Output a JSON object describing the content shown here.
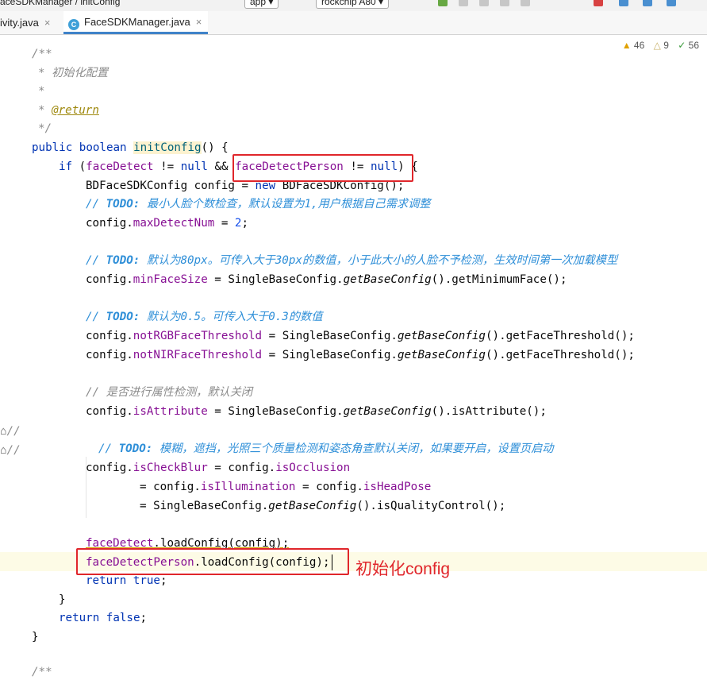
{
  "topbar": {
    "breadcrumb": "aceSDKManager  /  initConfig",
    "run_config": "app ▾",
    "device": "rockchip A80 ▾"
  },
  "tabs": [
    {
      "label": "ivity.java",
      "close": "×"
    },
    {
      "label": "FaceSDKManager.java",
      "close": "×",
      "active": true
    }
  ],
  "inspections": {
    "warnings": "46",
    "weak_warnings": "9",
    "ok": "56"
  },
  "code": {
    "l1": "/**",
    "l2": "* 初始化配置",
    "l3": "*",
    "l4_star": "* ",
    "l4_ann": "@return",
    "l5": "*/",
    "l6_kw": "public boolean ",
    "l6_m": "initConfig",
    "l6_rest": "() {",
    "l7_kw": "if ",
    "l7_a": "(",
    "l7_f1": "faceDetect",
    "l7_b": " != ",
    "l7_null1": "null",
    "l7_c": " && ",
    "l7_f2": "faceDetectPerson",
    "l7_d": " != ",
    "l7_null2": "null",
    "l7_e": ") {",
    "l8_a": "BDFaceSDKConfig config = ",
    "l8_kw": "new",
    "l8_b": " BDFaceSDKConfig();",
    "l9_slash": "// ",
    "l9_todo": "TODO:",
    "l9_text": " 最小人脸个数检查，默认设置为1,用户根据自己需求调整",
    "l10_a": "config.",
    "l10_f": "maxDetectNum",
    "l10_b": " = ",
    "l10_n": "2",
    "l10_c": ";",
    "l11_slash": "// ",
    "l11_todo": "TODO:",
    "l11_text": " 默认为80px。可传入大于30px的数值，小于此大小的人脸不予检测，生效时间第一次加载模型",
    "l12_a": "config.",
    "l12_f": "minFaceSize",
    "l12_b": " = SingleBaseConfig.",
    "l12_s": "getBaseConfig",
    "l12_c": "().getMinimumFace();",
    "l13_slash": "// ",
    "l13_todo": "TODO:",
    "l13_text": " 默认为0.5。可传入大于0.3的数值",
    "l14_a": "config.",
    "l14_f": "notRGBFaceThreshold",
    "l14_b": " = SingleBaseConfig.",
    "l14_s": "getBaseConfig",
    "l14_c": "().getFaceThreshold();",
    "l15_a": "config.",
    "l15_f": "notNIRFaceThreshold",
    "l15_b": " = SingleBaseConfig.",
    "l15_s": "getBaseConfig",
    "l15_c": "().getFaceThreshold();",
    "l16": "// 是否进行属性检测，默认关闭",
    "l17_a": "config.",
    "l17_f": "isAttribute",
    "l17_b": " = SingleBaseConfig.",
    "l17_s": "getBaseConfig",
    "l17_c": "().isAttribute();",
    "l18_slash": "// ",
    "l18_todo": "TODO:",
    "l18_text": " 模糊，遮挡，光照三个质量检测和姿态角查默认关闭，如果要开启，设置页启动",
    "l19_a": "config.",
    "l19_f1": "isCheckBlur",
    "l19_b": " = config.",
    "l19_f2": "isOcclusion",
    "l20_a": "= config.",
    "l20_f1": "isIllumination",
    "l20_b": " = config.",
    "l20_f2": "isHeadPose",
    "l21_a": "= SingleBaseConfig.",
    "l21_s": "getBaseConfig",
    "l21_b": "().isQualityControl();",
    "l22_f": "faceDetect",
    "l22_b": ".loadConfig(config);",
    "l23_f": "faceDetectPerson",
    "l23_b": ".loadConfig(config);",
    "l24_kw": "return true",
    "l24_b": ";",
    "l25": "}",
    "l26_kw": "return false",
    "l26_b": ";",
    "l27": "}",
    "l28": "/**",
    "gutter_comment_1": "//",
    "gutter_comment_2": "//"
  },
  "annotation": "初始化config",
  "colors": {
    "annotation_red": "#e0262b",
    "keyword": "#0033b3",
    "field": "#871094",
    "method": "#00627a",
    "todo": "#2f8fd8",
    "comment": "#8c8c8c"
  }
}
